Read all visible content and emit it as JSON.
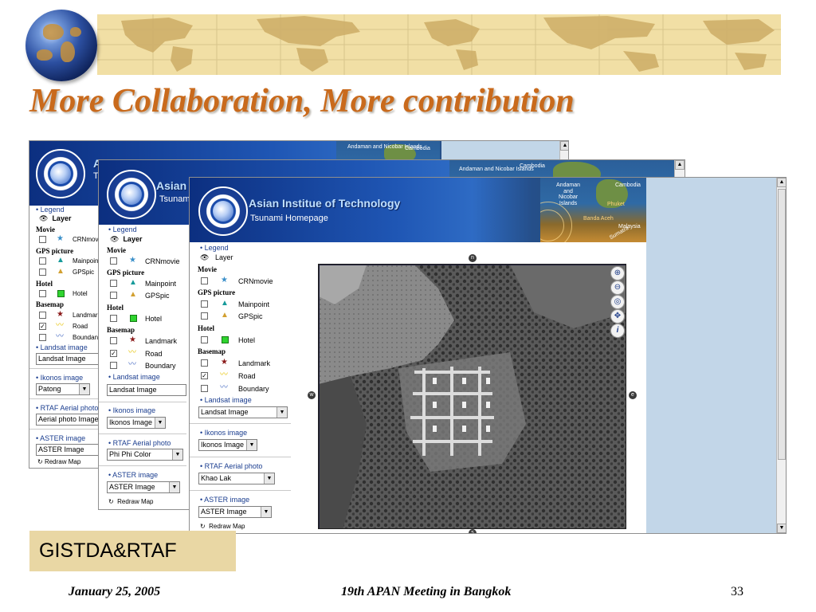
{
  "slide": {
    "title": "More Collaboration, More contribution",
    "credit": "GISTDA&RTAF",
    "footer": {
      "date": "January 25, 2005",
      "event": "19th APAN Meeting in Bangkok",
      "page": "33"
    }
  },
  "header": {
    "institute_full": "Asian Institue of Technology",
    "institute_short1": "Asi",
    "institute_short2": "Asian",
    "subtitle": "Tsunami Homepage",
    "sub_short1": "Tsu",
    "sub_short2": "Tsunam",
    "map_labels": [
      "Andaman and Nicobar Islands",
      "Cambodia",
      "Phuket",
      "Banda Aceh",
      "Malaysia",
      "Sumatra"
    ]
  },
  "legend": {
    "legend_label": "Legend",
    "layer_label": "Layer",
    "groups": {
      "movie": "Movie",
      "gps": "GPS picture",
      "hotel": "Hotel",
      "basemap": "Basemap"
    },
    "items": {
      "crnmovie": "CRNmovie",
      "crnmovie_cut": "CRNmov",
      "mainpoint": "Mainpoint",
      "mainpoint_cut": "Mainpoin",
      "gpspic": "GPSpic",
      "hotel": "Hotel",
      "landmark": "Landmark",
      "landmark_cut": "Landmar",
      "road": "Road",
      "boundary": "Boundary",
      "boundary_cut": "Boundan"
    }
  },
  "selectors": {
    "landsat_label": "Landsat image",
    "landsat_value": "Landsat Image",
    "ikonos_label": "Ikonos image",
    "ikonos_values": [
      "Patong",
      "Ikonos Image"
    ],
    "rtaf_label": "RTAF Aerial photo",
    "rtaf_values": [
      "Aerial photo Image",
      "Phi Phi Color",
      "Khao Lak"
    ],
    "aster_label": "ASTER image",
    "aster_value": "ASTER Image",
    "redraw": "Redraw Map"
  },
  "map": {
    "tools": [
      "zoom-in",
      "zoom-out",
      "zoom-full-extent",
      "pan",
      "identify"
    ],
    "tool_glyphs": [
      "⊕",
      "⊖",
      "◎",
      "✥",
      "i"
    ],
    "pan_glyphs": [
      "n",
      "w",
      "e",
      "s"
    ]
  },
  "colors": {
    "title_orange": "#c96a1c",
    "credit_bg": "#e9d7a4",
    "banner_bg": "#f1dfa5",
    "map_panel": "#c2d6e8",
    "header_blue": "#1f56b4"
  }
}
